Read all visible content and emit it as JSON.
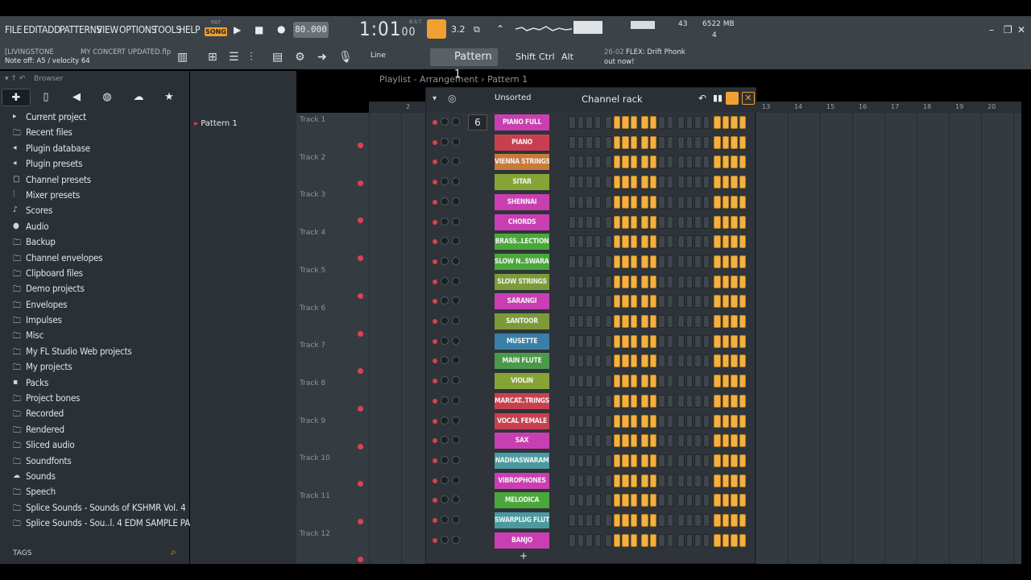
{
  "menu": [
    "FILE",
    "EDIT",
    "ADD",
    "PATTERNS",
    "VIEW",
    "OPTIONS",
    "TOOLS",
    "HELP"
  ],
  "transport": {
    "pat_label": "PAT",
    "song_label": "SONG",
    "tempo": "80.000",
    "time": "1:01",
    "time_ticks": "00",
    "time_unit": "B:S:T"
  },
  "status": {
    "cpu_value": "43",
    "memory": "6522 MB",
    "polyphony": "4"
  },
  "hint": {
    "user": "[LIVINGSTONE",
    "project": "MY CONCERT UPDATED.flp",
    "line2": "Note off: A5 / velocity 64"
  },
  "toolbar": {
    "snap": "Line",
    "pattern": "Pattern 1",
    "shift": "Shift",
    "ctrl": "Ctrl",
    "alt": "Alt"
  },
  "news": {
    "date": "26-02",
    "title": "FLEX: Drift Phonk",
    "subtitle": "out now!"
  },
  "browser": {
    "title": "Browser",
    "tags_label": "TAGS",
    "items": [
      {
        "label": "Current project",
        "icon": "project-icon"
      },
      {
        "label": "Recent files",
        "icon": "folder-icon"
      },
      {
        "label": "Plugin database",
        "icon": "plug-icon"
      },
      {
        "label": "Plugin presets",
        "icon": "plug-icon"
      },
      {
        "label": "Channel presets",
        "icon": "channel-icon"
      },
      {
        "label": "Mixer presets",
        "icon": "mixer-icon"
      },
      {
        "label": "Scores",
        "icon": "note-icon"
      },
      {
        "label": "Audio",
        "icon": "user-icon"
      },
      {
        "label": "Backup",
        "icon": "folder-icon"
      },
      {
        "label": "Channel envelopes",
        "icon": "folder-icon"
      },
      {
        "label": "Clipboard files",
        "icon": "folder-icon"
      },
      {
        "label": "Demo projects",
        "icon": "folder-icon"
      },
      {
        "label": "Envelopes",
        "icon": "folder-icon"
      },
      {
        "label": "Impulses",
        "icon": "folder-icon"
      },
      {
        "label": "Misc",
        "icon": "folder-icon"
      },
      {
        "label": "My FL Studio Web projects",
        "icon": "folder-icon"
      },
      {
        "label": "My projects",
        "icon": "folder-icon"
      },
      {
        "label": "Packs",
        "icon": "pack-icon"
      },
      {
        "label": "Project bones",
        "icon": "folder-icon"
      },
      {
        "label": "Recorded",
        "icon": "folder-icon"
      },
      {
        "label": "Rendered",
        "icon": "folder-icon"
      },
      {
        "label": "Sliced audio",
        "icon": "folder-icon"
      },
      {
        "label": "Soundfonts",
        "icon": "folder-icon"
      },
      {
        "label": "Sounds",
        "icon": "cloud-icon"
      },
      {
        "label": "Speech",
        "icon": "folder-icon"
      },
      {
        "label": "Splice Sounds - Sounds of KSHMR Vol. 4",
        "icon": "folder-icon"
      },
      {
        "label": "Splice Sounds - Sou..l. 4 EDM SAMPLE PACKs",
        "icon": "folder-icon"
      }
    ]
  },
  "playlist": {
    "title": "Playlist - Arrangement",
    "pattern": "Pattern 1",
    "pattern_item": "Pattern 1",
    "tracks": [
      "Track 1",
      "Track 2",
      "Track 3",
      "Track 4",
      "Track 5",
      "Track 6",
      "Track 7",
      "Track 8",
      "Track 9",
      "Track 10",
      "Track 11",
      "Track 12"
    ],
    "ruler": [
      "2",
      "13",
      "14",
      "15",
      "16",
      "17",
      "18",
      "19",
      "20"
    ]
  },
  "channel_rack": {
    "title": "Channel rack",
    "sort": "Unsorted",
    "channel_number": "6",
    "channels": [
      {
        "name": "PIANO FULL",
        "color": "#c93fb1"
      },
      {
        "name": "PIANO",
        "color": "#c8404f"
      },
      {
        "name": "VIENNA STRINGS",
        "color": "#c87a3a"
      },
      {
        "name": "SITAR",
        "color": "#86a436"
      },
      {
        "name": "SHENNAI",
        "color": "#c93fb1"
      },
      {
        "name": "CHORDS",
        "color": "#c93fb1"
      },
      {
        "name": "BRASS..LECTION",
        "color": "#4aa83a"
      },
      {
        "name": "SLOW N..SWARAM",
        "color": "#4aa83a"
      },
      {
        "name": "SLOW STRINGS",
        "color": "#7d9a3a"
      },
      {
        "name": "SARANGI",
        "color": "#c93fb1"
      },
      {
        "name": "SANTOOR",
        "color": "#7d9a3a"
      },
      {
        "name": "MUSETTE",
        "color": "#3a7fa8"
      },
      {
        "name": "MAIN FLUTE",
        "color": "#4a9a4a"
      },
      {
        "name": "VIOLIN",
        "color": "#86a436"
      },
      {
        "name": "MARCAT..TRINGS",
        "color": "#c8404f"
      },
      {
        "name": "VOCAL FEMALE",
        "color": "#c8404f"
      },
      {
        "name": "SAX",
        "color": "#c93fb1"
      },
      {
        "name": "NADHASWARAM",
        "color": "#4a9aa0"
      },
      {
        "name": "VIBROPHONES",
        "color": "#c93fb1"
      },
      {
        "name": "MELODICA",
        "color": "#4aa83a"
      },
      {
        "name": "SWARPLUG FLUTE",
        "color": "#4a9aa0"
      },
      {
        "name": "BANJO",
        "color": "#c93fb1"
      }
    ],
    "steps_pattern": [
      0,
      0,
      0,
      0,
      0,
      1,
      1,
      1,
      1,
      1,
      0,
      0,
      0,
      0,
      0,
      0,
      1,
      1,
      1,
      1
    ]
  }
}
